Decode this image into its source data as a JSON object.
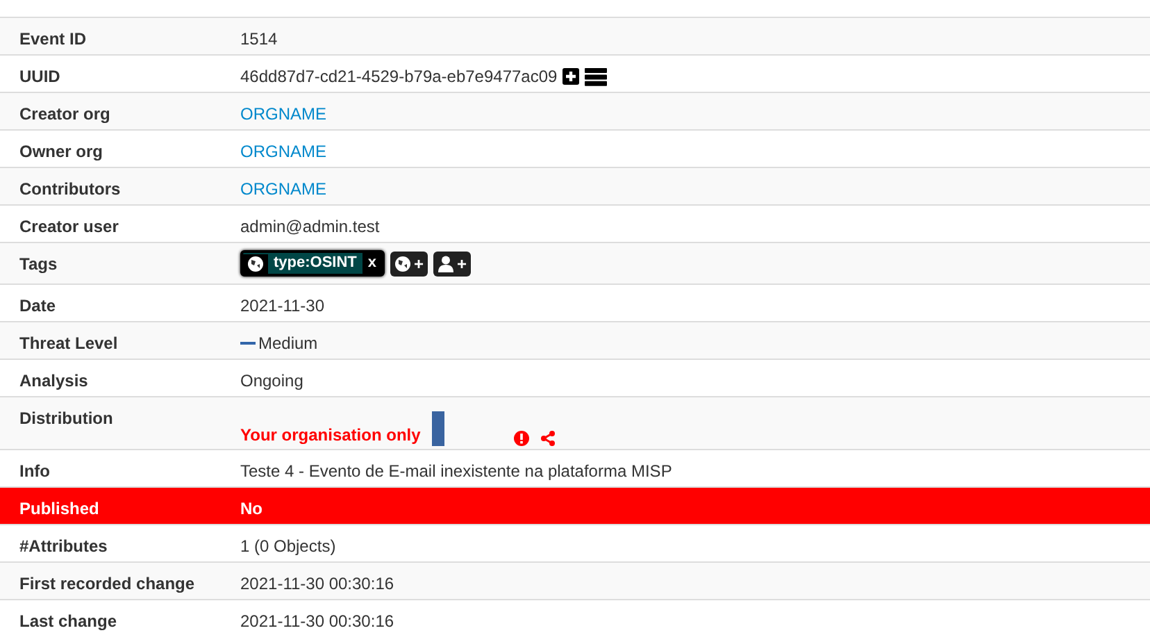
{
  "rows": [
    {
      "label": "Event ID",
      "kind": "text",
      "value": "1514"
    },
    {
      "label": "UUID",
      "kind": "uuid",
      "value": "46dd87d7-cd21-4529-b79a-eb7e9477ac09"
    },
    {
      "label": "Creator org",
      "kind": "link",
      "value": "ORGNAME"
    },
    {
      "label": "Owner org",
      "kind": "link",
      "value": "ORGNAME"
    },
    {
      "label": "Contributors",
      "kind": "link",
      "value": "ORGNAME"
    },
    {
      "label": "Creator user",
      "kind": "text",
      "value": "admin@admin.test"
    },
    {
      "label": "Tags",
      "kind": "tags",
      "tags": [
        {
          "name": "type:OSINT",
          "color": "#004646",
          "remove": "x"
        }
      ],
      "add_buttons": [
        "+",
        "+"
      ]
    },
    {
      "label": "Date",
      "kind": "text",
      "value": "2021-11-30"
    },
    {
      "label": "Threat Level",
      "kind": "threat",
      "value": "Medium"
    },
    {
      "label": "Analysis",
      "kind": "text",
      "value": "Ongoing"
    },
    {
      "label": "Distribution",
      "kind": "distribution",
      "value": "Your organisation only"
    },
    {
      "label": "Info",
      "kind": "text",
      "value": "Teste 4 - Evento de E-mail inexistente na plataforma MISP"
    },
    {
      "label": "Published",
      "kind": "published",
      "value": "No"
    },
    {
      "label": "#Attributes",
      "kind": "text",
      "value": "1 (0 Objects)"
    },
    {
      "label": "First recorded change",
      "kind": "text",
      "value": "2021-11-30 00:30:16"
    },
    {
      "label": "Last change",
      "kind": "text",
      "value": "2021-11-30 00:30:16"
    }
  ]
}
